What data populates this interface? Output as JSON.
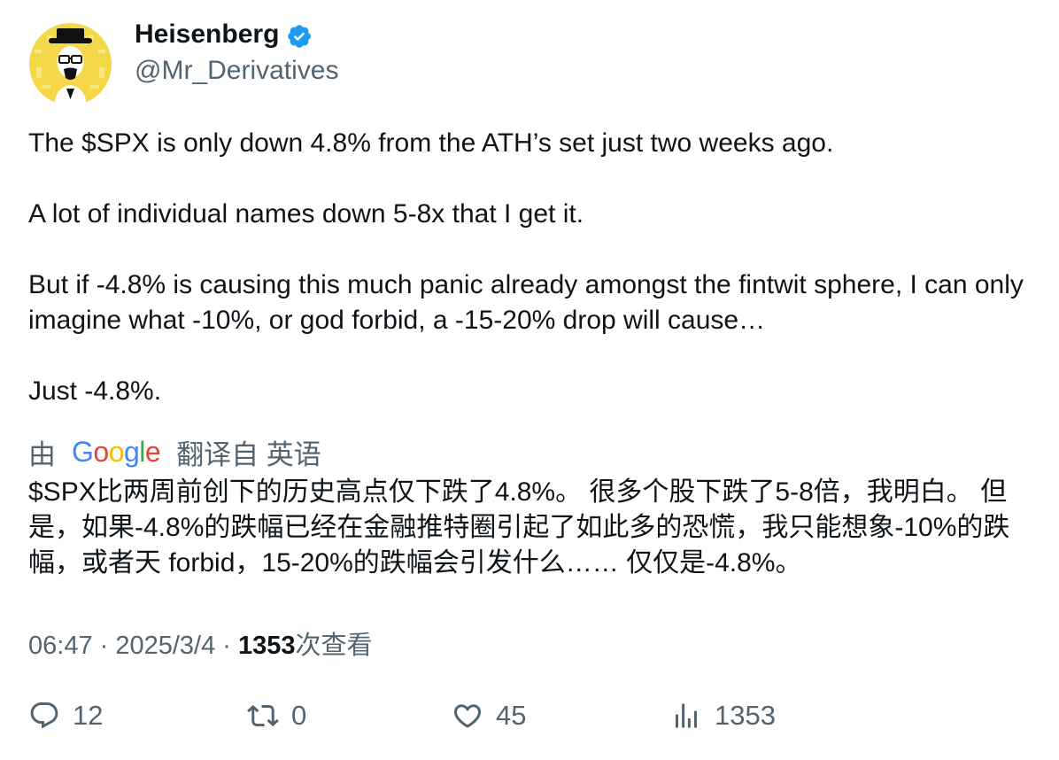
{
  "author": {
    "display_name": "Heisenberg",
    "handle": "@Mr_Derivatives",
    "verified": true,
    "avatar_icon": "heisenberg-avatar-icon",
    "verified_icon": "verified-badge-icon",
    "accent_color": "#1d9bf0",
    "avatar_bg_color": "#f5d84a"
  },
  "tweet": {
    "paragraphs": [
      "The $SPX is only down 4.8% from the ATH’s set just two weeks ago.",
      "A lot of individual names down 5-8x that I get it.",
      "But if -4.8% is causing this much panic already amongst the fintwit sphere, I can only imagine what -10%, or god forbid, a -15-20% drop will cause…",
      "Just -4.8%."
    ]
  },
  "translation": {
    "prefix": "由",
    "provider": "Google",
    "suffix": "翻译自 英语",
    "text": "$SPX比两周前创下的历史高点仅下跌了4.8%。 很多个股下跌了5-8倍，我明白。 但是，如果-4.8%的跌幅已经在金融推特圈引起了如此多的恐慌，我只能想象-10%的跌幅，或者天 forbid，15-20%的跌幅会引发什么…… 仅仅是-4.8%。"
  },
  "meta": {
    "time": "06:47",
    "separator": " · ",
    "date": "2025/3/4",
    "views_count": "1353",
    "views_label": "次查看"
  },
  "actions": {
    "reply": {
      "icon": "reply-icon",
      "count": "12"
    },
    "retweet": {
      "icon": "retweet-icon",
      "count": "0"
    },
    "like": {
      "icon": "heart-icon",
      "count": "45"
    },
    "views": {
      "icon": "views-bar-chart-icon",
      "count": "1353"
    }
  }
}
